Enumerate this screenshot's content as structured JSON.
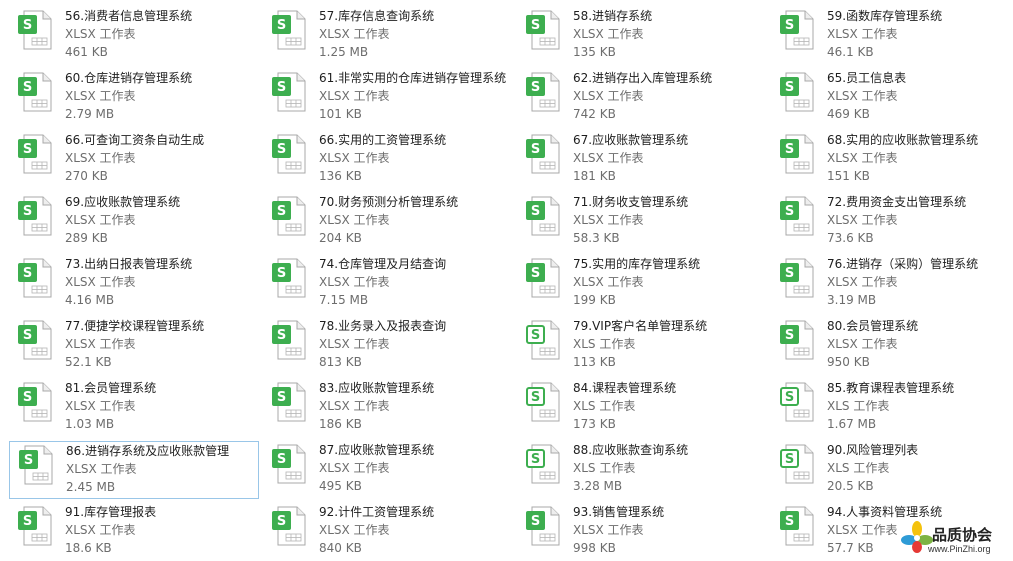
{
  "colors": {
    "xlsx_icon": "#3dae4f",
    "xls_icon": "#3dae4f",
    "selection_border": "#99c6e8"
  },
  "files": [
    {
      "name": "56.消费者信息管理系统",
      "type": "XLSX 工作表",
      "size": "461 KB",
      "icon": "xlsx-file-icon"
    },
    {
      "name": "57.库存信息查询系统",
      "type": "XLSX 工作表",
      "size": "1.25 MB",
      "icon": "xlsx-file-icon"
    },
    {
      "name": "58.进销存系统",
      "type": "XLSX 工作表",
      "size": "135 KB",
      "icon": "xlsx-file-icon"
    },
    {
      "name": "59.函数库存管理系统",
      "type": "XLSX 工作表",
      "size": "46.1 KB",
      "icon": "xlsx-file-icon"
    },
    {
      "name": "60.仓库进销存管理系统",
      "type": "XLSX 工作表",
      "size": "2.79 MB",
      "icon": "xlsx-file-icon"
    },
    {
      "name": "61.非常实用的仓库进销存管理系统",
      "type": "XLSX 工作表",
      "size": "101 KB",
      "icon": "xlsx-file-icon"
    },
    {
      "name": "62.进销存出入库管理系统",
      "type": "XLSX 工作表",
      "size": "742 KB",
      "icon": "xlsx-file-icon"
    },
    {
      "name": "65.员工信息表",
      "type": "XLSX 工作表",
      "size": "469 KB",
      "icon": "xlsx-file-icon"
    },
    {
      "name": "66.可查询工资条自动生成",
      "type": "XLSX 工作表",
      "size": "270 KB",
      "icon": "xlsx-file-icon"
    },
    {
      "name": "66.实用的工资管理系统",
      "type": "XLSX 工作表",
      "size": "136 KB",
      "icon": "xlsx-file-icon"
    },
    {
      "name": "67.应收账款管理系统",
      "type": "XLSX 工作表",
      "size": "181 KB",
      "icon": "xlsx-file-icon"
    },
    {
      "name": "68.实用的应收账款管理系统",
      "type": "XLSX 工作表",
      "size": "151 KB",
      "icon": "xlsx-file-icon"
    },
    {
      "name": "69.应收账款管理系统",
      "type": "XLSX 工作表",
      "size": "289 KB",
      "icon": "xlsx-file-icon"
    },
    {
      "name": "70.财务预测分析管理系统",
      "type": "XLSX 工作表",
      "size": "204 KB",
      "icon": "xlsx-file-icon"
    },
    {
      "name": "71.财务收支管理系统",
      "type": "XLSX 工作表",
      "size": "58.3 KB",
      "icon": "xlsx-file-icon"
    },
    {
      "name": "72.费用资金支出管理系统",
      "type": "XLSX 工作表",
      "size": "73.6 KB",
      "icon": "xlsx-file-icon"
    },
    {
      "name": "73.出纳日报表管理系统",
      "type": "XLSX 工作表",
      "size": "4.16 MB",
      "icon": "xlsx-file-icon"
    },
    {
      "name": "74.仓库管理及月结查询",
      "type": "XLSX 工作表",
      "size": "7.15 MB",
      "icon": "xlsx-file-icon"
    },
    {
      "name": "75.实用的库存管理系统",
      "type": "XLSX 工作表",
      "size": "199 KB",
      "icon": "xlsx-file-icon"
    },
    {
      "name": "76.进销存（采购）管理系统",
      "type": "XLSX 工作表",
      "size": "3.19 MB",
      "icon": "xlsx-file-icon"
    },
    {
      "name": "77.便捷学校课程管理系统",
      "type": "XLSX 工作表",
      "size": "52.1 KB",
      "icon": "xlsx-file-icon"
    },
    {
      "name": "78.业务录入及报表查询",
      "type": "XLSX 工作表",
      "size": "813 KB",
      "icon": "xlsx-file-icon"
    },
    {
      "name": "79.VIP客户名单管理系统",
      "type": "XLS 工作表",
      "size": "113 KB",
      "icon": "xls-file-icon"
    },
    {
      "name": "80.会员管理系统",
      "type": "XLSX 工作表",
      "size": "950 KB",
      "icon": "xlsx-file-icon"
    },
    {
      "name": "81.会员管理系统",
      "type": "XLSX 工作表",
      "size": "1.03 MB",
      "icon": "xlsx-file-icon"
    },
    {
      "name": "83.应收账款管理系统",
      "type": "XLSX 工作表",
      "size": "186 KB",
      "icon": "xlsx-file-icon"
    },
    {
      "name": "84.课程表管理系统",
      "type": "XLS 工作表",
      "size": "173 KB",
      "icon": "xls-file-icon"
    },
    {
      "name": "85.教育课程表管理系统",
      "type": "XLS 工作表",
      "size": "1.67 MB",
      "icon": "xls-file-icon"
    },
    {
      "name": "86.进销存系统及应收账款管理",
      "type": "XLSX 工作表",
      "size": "2.45 MB",
      "icon": "xlsx-file-icon",
      "selected": true
    },
    {
      "name": "87.应收账款管理系统",
      "type": "XLSX 工作表",
      "size": "495 KB",
      "icon": "xlsx-file-icon"
    },
    {
      "name": "88.应收账款查询系统",
      "type": "XLS 工作表",
      "size": "3.28 MB",
      "icon": "xls-file-icon"
    },
    {
      "name": "90.风险管理列表",
      "type": "XLS 工作表",
      "size": "20.5 KB",
      "icon": "xls-file-icon"
    },
    {
      "name": "91.库存管理报表",
      "type": "XLSX 工作表",
      "size": "18.6 KB",
      "icon": "xlsx-file-icon"
    },
    {
      "name": "92.计件工资管理系统",
      "type": "XLSX 工作表",
      "size": "840 KB",
      "icon": "xlsx-file-icon"
    },
    {
      "name": "93.销售管理系统",
      "type": "XLSX 工作表",
      "size": "998 KB",
      "icon": "xlsx-file-icon"
    },
    {
      "name": "94.人事资料管理系统",
      "type": "XLSX 工作表",
      "size": "57.7 KB",
      "icon": "xlsx-file-icon"
    }
  ],
  "watermark": {
    "title": "品质协会",
    "url": "www.PinZhi.org",
    "icon": "flower-logo-icon"
  }
}
